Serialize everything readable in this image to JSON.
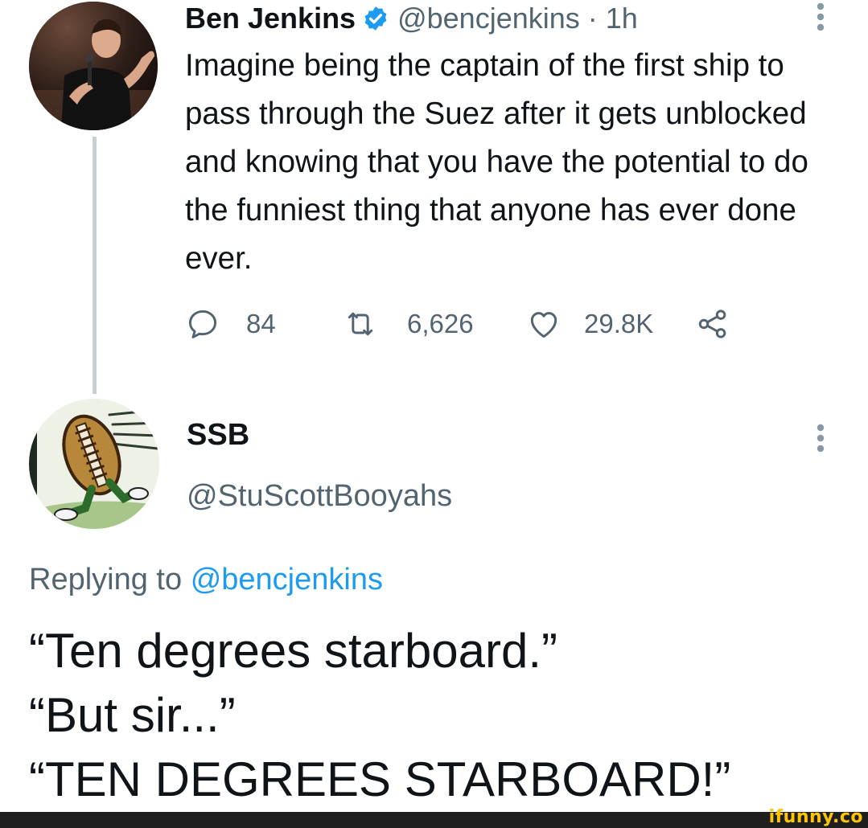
{
  "tweet": {
    "author_name": "Ben Jenkins",
    "author_handle": "@bencjenkins",
    "separator": "·",
    "time": "1h",
    "text": "Imagine being the captain of the first ship to pass through the Suez after it gets unblocked and knowing that you have the potential to do the funniest thing that anyone has ever done ever.",
    "reply_count": "84",
    "retweet_count": "6,626",
    "like_count": "29.8K"
  },
  "reply": {
    "author_name": "SSB",
    "author_handle": "@StuScottBooyahs",
    "replying_prefix": "Replying to",
    "replying_to": "@bencjenkins",
    "text": "“Ten degrees starboard.”\n“But sir...”\n“TEN DEGREES STARBOARD!”"
  },
  "watermark": "ifunny.co",
  "colors": {
    "text_primary": "#0f1419",
    "text_secondary": "#536471",
    "link": "#1d9bf0",
    "verified": "#1d9bf0",
    "thread_line": "#c4cfd6",
    "watermark": "#ffc600"
  },
  "icons": [
    "verified-badge-icon",
    "more-options-icon",
    "reply-icon",
    "retweet-icon",
    "like-icon",
    "share-icon"
  ]
}
